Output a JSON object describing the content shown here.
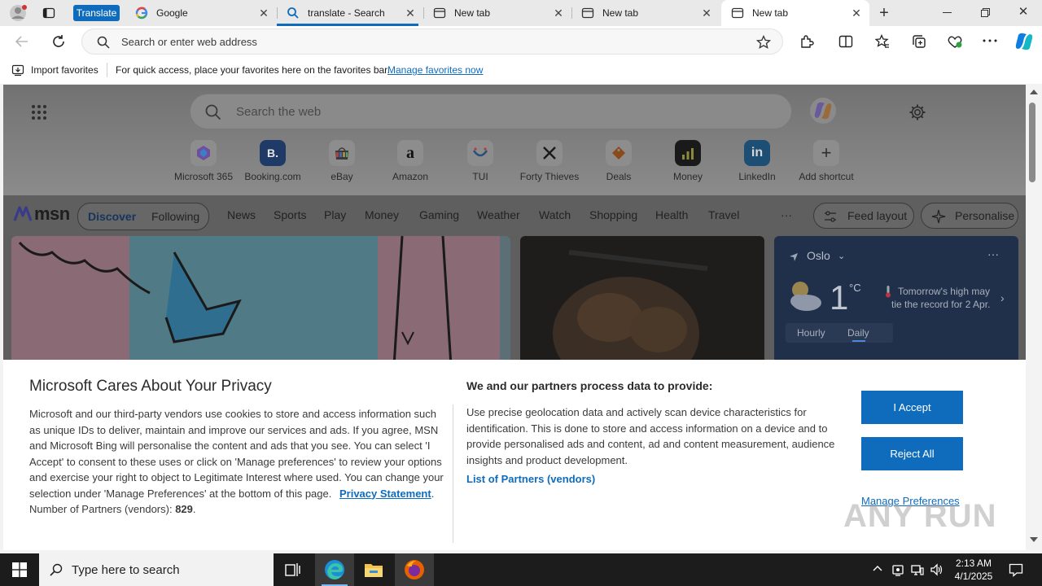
{
  "browser": {
    "translate_badge": "Translate",
    "tabs": [
      {
        "title": "Google"
      },
      {
        "title": "translate - Search"
      },
      {
        "title": "New tab"
      },
      {
        "title": "New tab"
      },
      {
        "title": "New tab"
      }
    ],
    "address_placeholder": "Search or enter web address",
    "favorites_bar": {
      "import_label": "Import favorites",
      "hint": "For quick access, place your favorites here on the favorites bar.",
      "manage_link": "Manage favorites now"
    }
  },
  "newtab": {
    "search_placeholder": "Search the web",
    "shortcuts": [
      {
        "label": "Microsoft 365",
        "icon": "microsoft365-icon"
      },
      {
        "label": "Booking.com",
        "icon": "booking-icon",
        "glyph": "B."
      },
      {
        "label": "eBay",
        "icon": "ebay-icon"
      },
      {
        "label": "Amazon",
        "icon": "amazon-icon",
        "glyph": "a"
      },
      {
        "label": "TUI",
        "icon": "tui-icon"
      },
      {
        "label": "Forty Thieves",
        "icon": "swords-icon"
      },
      {
        "label": "Deals",
        "icon": "tag-icon"
      },
      {
        "label": "Money",
        "icon": "money-chart-icon"
      },
      {
        "label": "LinkedIn",
        "icon": "linkedin-icon",
        "glyph": "in"
      },
      {
        "label": "Add shortcut",
        "icon": "plus-icon",
        "glyph": "+"
      }
    ],
    "msn": {
      "logo_text": "msn",
      "tabs": [
        "Discover",
        "Following"
      ],
      "nav": [
        "News",
        "Sports",
        "Play",
        "Money",
        "Gaming",
        "Weather",
        "Watch",
        "Shopping",
        "Health",
        "Travel"
      ],
      "more": "···",
      "feed_layout": "Feed layout",
      "personalise": "Personalise"
    },
    "weather": {
      "city": "Oslo",
      "temp": "1",
      "unit": "°C",
      "note_line1": "Tomorrow's high may",
      "note_line2": "tie the record for 2 Apr.",
      "tabs": [
        "Hourly",
        "Daily"
      ]
    }
  },
  "privacy": {
    "title": "Microsoft Cares About Your Privacy",
    "body": "Microsoft and our third-party vendors use cookies to store and access information such as unique IDs to deliver, maintain and improve our services and ads. If you agree, MSN and Microsoft Bing will personalise the content and ads that you see. You can select 'I Accept' to consent to these uses or click on 'Manage preferences' to review your options and exercise your right to object to Legitimate Interest where used. You can change your selection under 'Manage Preferences' at the bottom of this page.",
    "privacy_link": "Privacy Statement",
    "period": ".",
    "partners_count_label": "Number of Partners (vendors):",
    "partners_count": "829",
    "right_title": "We and our partners process data to provide:",
    "right_body": "Use precise geolocation data and actively scan device characteristics for identification. This is done to store and access information on a device and to provide personalised ads and content, ad and content measurement, audience insights and product development.",
    "partners_link": "List of Partners (vendors)",
    "accept": "I Accept",
    "reject": "Reject All",
    "manage": "Manage Preferences"
  },
  "watermark": "ANY RUN",
  "taskbar": {
    "search_placeholder": "Type here to search",
    "time": "2:13 AM",
    "date": "4/1/2025"
  }
}
